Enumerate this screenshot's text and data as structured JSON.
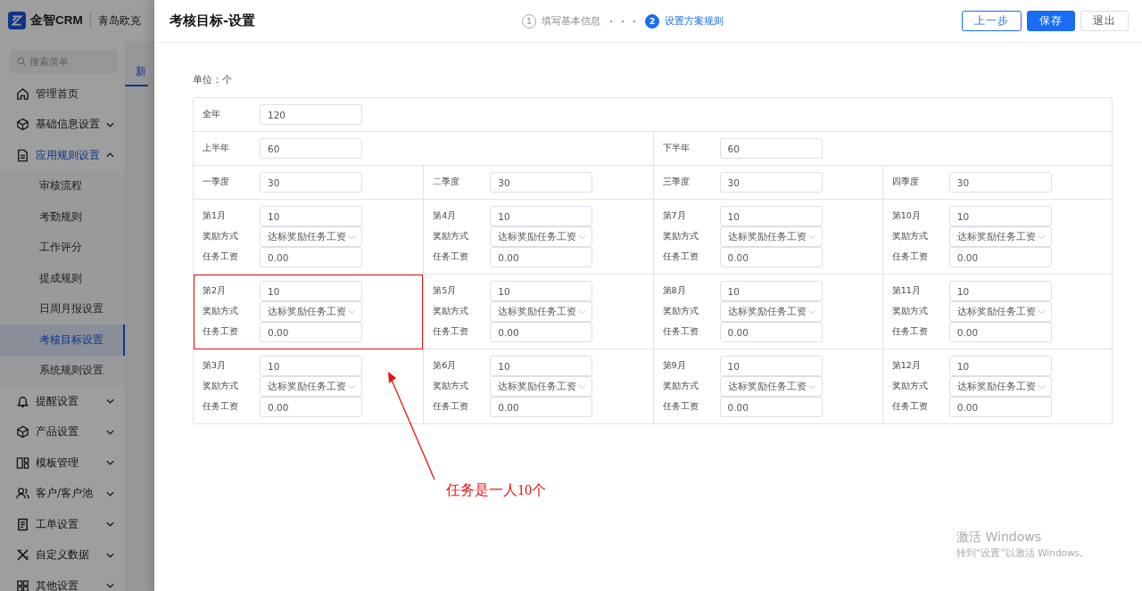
{
  "app_header": {
    "brand": "金智CRM",
    "company": "青岛欧克"
  },
  "sidebar": {
    "search_placeholder": "搜索菜单",
    "items": [
      {
        "label": "管理首页",
        "kind": "link"
      },
      {
        "label": "基础信息设置",
        "kind": "group",
        "expanded": false
      },
      {
        "label": "应用规则设置",
        "kind": "group",
        "expanded": true,
        "children": [
          {
            "label": "审核流程",
            "selected": false
          },
          {
            "label": "考勤规则",
            "selected": false
          },
          {
            "label": "工作评分",
            "selected": false
          },
          {
            "label": "提成规则",
            "selected": false
          },
          {
            "label": "日周月报设置",
            "selected": false
          },
          {
            "label": "考核目标设置",
            "selected": true
          },
          {
            "label": "系统规则设置",
            "selected": false
          }
        ]
      },
      {
        "label": "提醒设置",
        "kind": "group",
        "expanded": false
      },
      {
        "label": "产品设置",
        "kind": "group",
        "expanded": false
      },
      {
        "label": "模板管理",
        "kind": "group",
        "expanded": false
      },
      {
        "label": "客户/客户池",
        "kind": "group",
        "expanded": false
      },
      {
        "label": "工单设置",
        "kind": "group",
        "expanded": false
      },
      {
        "label": "自定义数据",
        "kind": "group",
        "expanded": false
      },
      {
        "label": "其他设置",
        "kind": "group",
        "expanded": false
      }
    ]
  },
  "background_tab": "新",
  "drawer": {
    "title": "考核目标-设置",
    "steps": [
      {
        "number": "1",
        "label": "填写基本信息",
        "selected": false
      },
      {
        "number": "2",
        "label": "设置方案规则",
        "selected": true
      }
    ],
    "buttons": [
      {
        "label": "上一步",
        "kind": "outline"
      },
      {
        "label": "保存",
        "kind": "primary"
      },
      {
        "label": "退出",
        "kind": "default"
      }
    ],
    "unit": "单位：个",
    "rows": [
      [
        {
          "kind": "simple",
          "label": "全年",
          "value": "120"
        },
        "",
        "",
        ""
      ],
      [
        {
          "kind": "simple",
          "label": "上半年",
          "value": "60"
        },
        "",
        {
          "kind": "simple",
          "label": "下半年",
          "value": "60"
        },
        ""
      ],
      [
        {
          "kind": "simple",
          "label": "一季度",
          "value": "30"
        },
        {
          "kind": "simple",
          "label": "二季度",
          "value": "30"
        },
        {
          "kind": "simple",
          "label": "三季度",
          "value": "30"
        },
        {
          "kind": "simple",
          "label": "四季度",
          "value": "30"
        }
      ],
      [
        {
          "kind": "month",
          "label": "第1月",
          "value": "10",
          "reward_label": "奖励方式",
          "reward": "达标奖励任务工资",
          "wage_label": "任务工资",
          "wage": "0.00",
          "annotated": false
        },
        {
          "kind": "month",
          "label": "第4月",
          "value": "10",
          "reward_label": "奖励方式",
          "reward": "达标奖励任务工资",
          "wage_label": "任务工资",
          "wage": "0.00",
          "annotated": false
        },
        {
          "kind": "month",
          "label": "第7月",
          "value": "10",
          "reward_label": "奖励方式",
          "reward": "达标奖励任务工资",
          "wage_label": "任务工资",
          "wage": "0.00",
          "annotated": false
        },
        {
          "kind": "month",
          "label": "第10月",
          "value": "10",
          "reward_label": "奖励方式",
          "reward": "达标奖励任务工资",
          "wage_label": "任务工资",
          "wage": "0.00",
          "annotated": false
        }
      ],
      [
        {
          "kind": "month",
          "label": "第2月",
          "value": "10",
          "reward_label": "奖励方式",
          "reward": "达标奖励任务工资",
          "wage_label": "任务工资",
          "wage": "0.00",
          "annotated": true
        },
        {
          "kind": "month",
          "label": "第5月",
          "value": "10",
          "reward_label": "奖励方式",
          "reward": "达标奖励任务工资",
          "wage_label": "任务工资",
          "wage": "0.00",
          "annotated": false
        },
        {
          "kind": "month",
          "label": "第8月",
          "value": "10",
          "reward_label": "奖励方式",
          "reward": "达标奖励任务工资",
          "wage_label": "任务工资",
          "wage": "0.00",
          "annotated": false
        },
        {
          "kind": "month",
          "label": "第11月",
          "value": "10",
          "reward_label": "奖励方式",
          "reward": "达标奖励任务工资",
          "wage_label": "任务工资",
          "wage": "0.00",
          "annotated": false
        }
      ],
      [
        {
          "kind": "month",
          "label": "第3月",
          "value": "10",
          "reward_label": "奖励方式",
          "reward": "达标奖励任务工资",
          "wage_label": "任务工资",
          "wage": "0.00",
          "annotated": false
        },
        {
          "kind": "month",
          "label": "第6月",
          "value": "10",
          "reward_label": "奖励方式",
          "reward": "达标奖励任务工资",
          "wage_label": "任务工资",
          "wage": "0.00",
          "annotated": false
        },
        {
          "kind": "month",
          "label": "第9月",
          "value": "10",
          "reward_label": "奖励方式",
          "reward": "达标奖励任务工资",
          "wage_label": "任务工资",
          "wage": "0.00",
          "annotated": false
        },
        {
          "kind": "month",
          "label": "第12月",
          "value": "10",
          "reward_label": "奖励方式",
          "reward": "达标奖励任务工资",
          "wage_label": "任务工资",
          "wage": "0.00",
          "annotated": false
        }
      ]
    ],
    "annotation": {
      "text": "任务是一人10个"
    }
  },
  "os_notice": {
    "title": "激活 Windows",
    "text": "转到“设置”以激活 Windows。"
  }
}
